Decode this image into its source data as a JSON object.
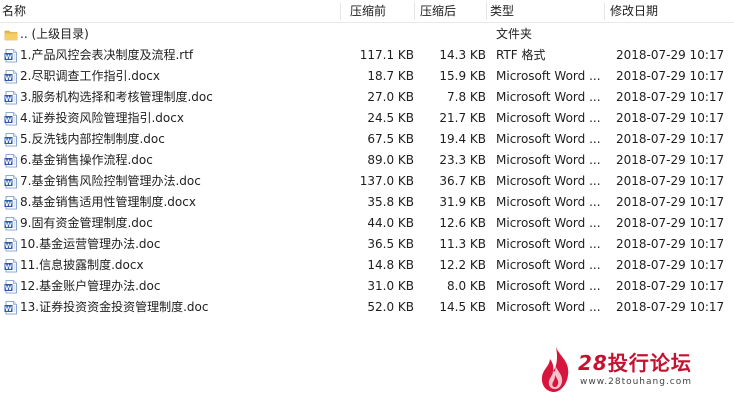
{
  "columns": {
    "name": "名称",
    "compressed": "压缩前",
    "size": "压缩后",
    "type": "类型",
    "modified": "修改日期"
  },
  "parent": {
    "name": ".. (上级目录)",
    "type": "文件夹"
  },
  "files": [
    {
      "name": "1.产品风控会表决制度及流程.rtf",
      "compressed": "117.1 KB",
      "size": "14.3 KB",
      "type": "RTF 格式",
      "modified": "2018-07-29 10:17",
      "icon": "rtf-document-icon"
    },
    {
      "name": "2.尽职调查工作指引.docx",
      "compressed": "18.7 KB",
      "size": "15.9 KB",
      "type": "Microsoft Word ...",
      "modified": "2018-07-29 10:17",
      "icon": "word-document-icon"
    },
    {
      "name": "3.服务机构选择和考核管理制度.doc",
      "compressed": "27.0 KB",
      "size": "7.8 KB",
      "type": "Microsoft Word ...",
      "modified": "2018-07-29 10:17",
      "icon": "word-document-icon"
    },
    {
      "name": "4.证券投资风险管理指引.docx",
      "compressed": "24.5 KB",
      "size": "21.7 KB",
      "type": "Microsoft Word ...",
      "modified": "2018-07-29 10:17",
      "icon": "word-document-icon"
    },
    {
      "name": "5.反洗钱内部控制制度.doc",
      "compressed": "67.5 KB",
      "size": "19.4 KB",
      "type": "Microsoft Word ...",
      "modified": "2018-07-29 10:17",
      "icon": "word-document-icon"
    },
    {
      "name": "6.基金销售操作流程.doc",
      "compressed": "89.0 KB",
      "size": "23.3 KB",
      "type": "Microsoft Word ...",
      "modified": "2018-07-29 10:17",
      "icon": "word-document-icon"
    },
    {
      "name": "7.基金销售风险控制管理办法.doc",
      "compressed": "137.0 KB",
      "size": "36.7 KB",
      "type": "Microsoft Word ...",
      "modified": "2018-07-29 10:17",
      "icon": "word-document-icon"
    },
    {
      "name": "8.基金销售适用性管理制度.docx",
      "compressed": "35.8 KB",
      "size": "31.9 KB",
      "type": "Microsoft Word ...",
      "modified": "2018-07-29 10:17",
      "icon": "word-document-icon"
    },
    {
      "name": "9.固有资金管理制度.doc",
      "compressed": "44.0 KB",
      "size": "12.6 KB",
      "type": "Microsoft Word ...",
      "modified": "2018-07-29 10:17",
      "icon": "word-document-icon"
    },
    {
      "name": "10.基金运营管理办法.doc",
      "compressed": "36.5 KB",
      "size": "11.3 KB",
      "type": "Microsoft Word ...",
      "modified": "2018-07-29 10:17",
      "icon": "word-document-icon"
    },
    {
      "name": "11.信息披露制度.docx",
      "compressed": "14.8 KB",
      "size": "12.2 KB",
      "type": "Microsoft Word ...",
      "modified": "2018-07-29 10:17",
      "icon": "word-document-icon"
    },
    {
      "name": "12.基金账户管理办法.doc",
      "compressed": "31.0 KB",
      "size": "8.0 KB",
      "type": "Microsoft Word ...",
      "modified": "2018-07-29 10:17",
      "icon": "word-document-icon"
    },
    {
      "name": "13.证券投资资金投资管理制度.doc",
      "compressed": "52.0 KB",
      "size": "14.5 KB",
      "type": "Microsoft Word ...",
      "modified": "2018-07-29 10:17",
      "icon": "word-document-icon"
    }
  ],
  "watermark": {
    "brand_number": "28",
    "brand_name": "投行论坛",
    "url": "www.28touhang.com",
    "color": "#c41230"
  }
}
